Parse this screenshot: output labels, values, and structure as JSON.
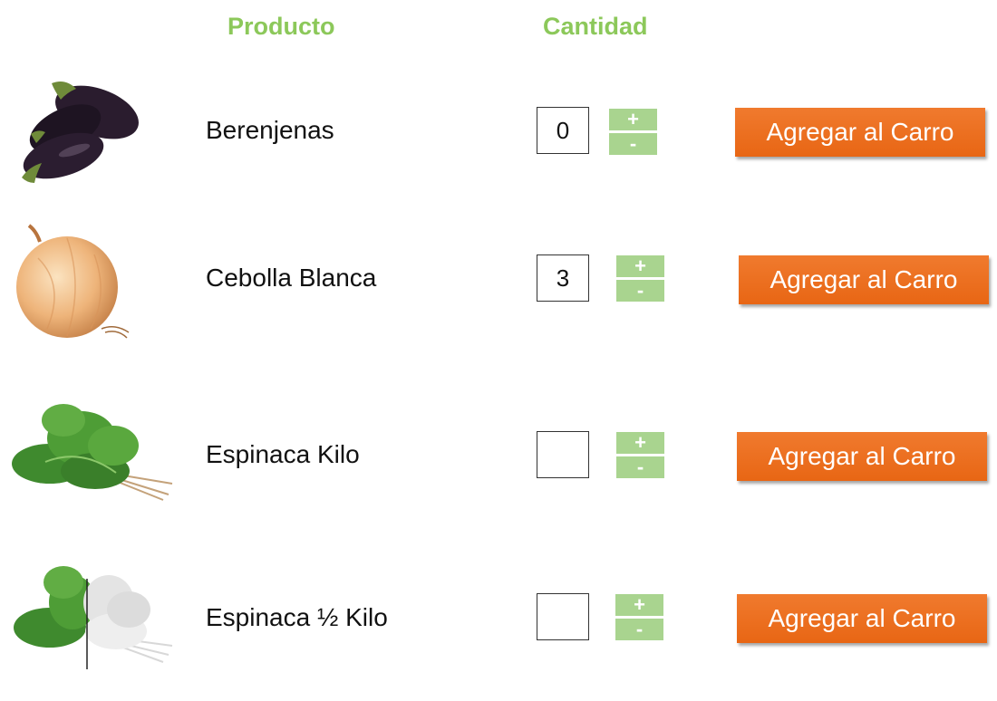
{
  "headers": {
    "product": "Producto",
    "quantity": "Cantidad"
  },
  "products": [
    {
      "name": "Berenjenas",
      "quantity": "0",
      "plus": "+",
      "minus": "-",
      "button": "Agregar al Carro"
    },
    {
      "name": "Cebolla Blanca",
      "quantity": "3",
      "plus": "+",
      "minus": "-",
      "button": "Agregar al Carro"
    },
    {
      "name": "Espinaca Kilo",
      "quantity": "",
      "plus": "+",
      "minus": "-",
      "button": "Agregar al Carro"
    },
    {
      "name": "Espinaca ½ Kilo",
      "quantity": "",
      "plus": "+",
      "minus": "-",
      "button": "Agregar al Carro"
    }
  ],
  "colors": {
    "header": "#8cc85a",
    "stepper": "#a9d48f",
    "button": "#ec7124"
  }
}
